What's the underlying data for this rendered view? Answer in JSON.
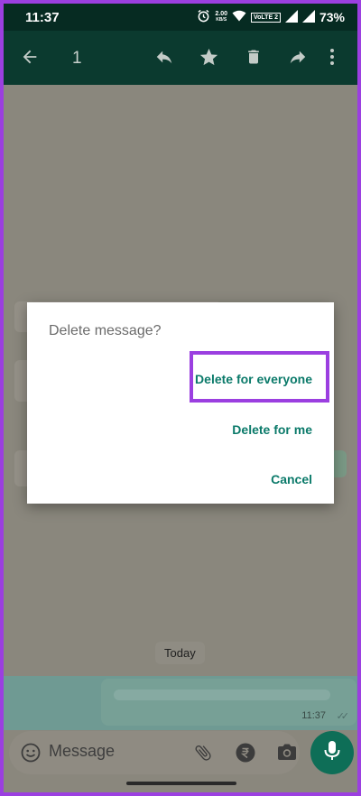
{
  "status_bar": {
    "time": "11:37",
    "net_speed_value": "2.00",
    "net_speed_unit": "KB/S",
    "volte": "VoLTE 2",
    "battery": "73%"
  },
  "action_bar": {
    "selected_count": "1",
    "icons": [
      "back-arrow-icon",
      "reply-icon",
      "star-icon",
      "delete-icon",
      "forward-icon",
      "more-vert-icon"
    ]
  },
  "chat": {
    "date_chip": "Today",
    "outgoing_time": "11:37",
    "outgoing_ticks": "✓✓"
  },
  "composer": {
    "placeholder": "Message",
    "icons": [
      "emoji-icon",
      "attach-icon",
      "rupee-icon",
      "camera-icon",
      "mic-icon"
    ]
  },
  "dialog": {
    "title": "Delete message?",
    "delete_for_everyone": "Delete for everyone",
    "delete_for_me": "Delete for me",
    "cancel": "Cancel"
  },
  "colors": {
    "accent": "#0b7a6a",
    "highlight": "#9b3fe0",
    "toolbar": "#0b3a2f",
    "mic": "#0e6e57"
  }
}
